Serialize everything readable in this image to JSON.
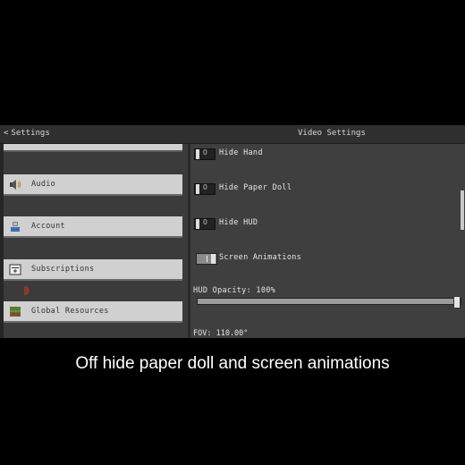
{
  "header": {
    "back_label": "Settings",
    "back_chevron": "<",
    "title": "Video Settings"
  },
  "sidebar": {
    "items": [
      {
        "label": "Audio",
        "icon": "speaker-icon"
      },
      {
        "label": "Account",
        "icon": "account-icon"
      },
      {
        "label": "Subscriptions",
        "icon": "subscriptions-icon"
      },
      {
        "label": "Global Resources",
        "icon": "global-resources-icon"
      }
    ]
  },
  "settings": {
    "toggles": [
      {
        "label": "Hide Hand",
        "state": "off",
        "glyph": "O"
      },
      {
        "label": "Hide Paper Doll",
        "state": "off",
        "glyph": "O"
      },
      {
        "label": "Hide HUD",
        "state": "off",
        "glyph": "O"
      },
      {
        "label": "Screen Animations",
        "state": "on"
      }
    ],
    "hud_opacity": {
      "label": "HUD Opacity: 100%",
      "value": 1.0
    },
    "fov": {
      "label": "FOV: 110.00°"
    }
  },
  "caption": "Off hide paper doll and screen animations",
  "colors": {
    "panel": "#4a4a4a",
    "button": "#d0d0d0",
    "text_light": "#e6e6e6"
  }
}
